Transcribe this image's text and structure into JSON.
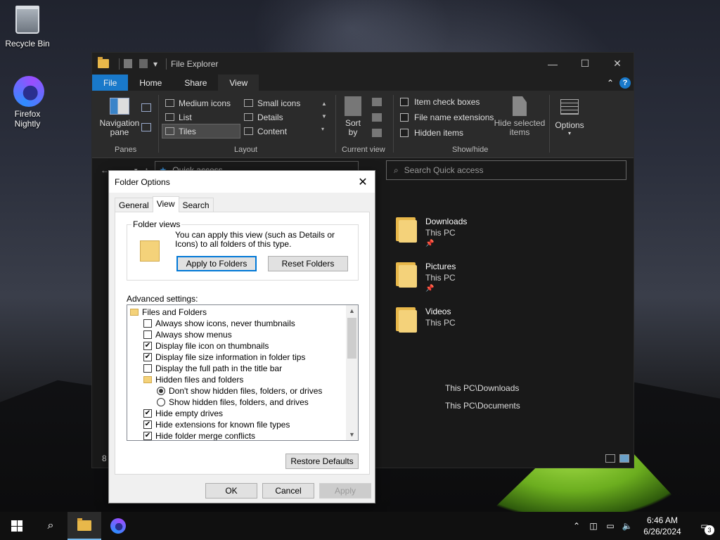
{
  "desktop": {
    "icons": [
      {
        "label": "Recycle Bin",
        "icon": "recycle-bin-icon"
      },
      {
        "label": "Firefox\nNightly",
        "icon": "firefox-nightly-icon"
      }
    ]
  },
  "explorer": {
    "title": "File Explorer",
    "menu": {
      "file": "File",
      "home": "Home",
      "share": "Share",
      "view": "View"
    },
    "ribbon": {
      "panes": {
        "nav_pane": "Navigation\npane",
        "group": "Panes"
      },
      "layout": {
        "group": "Layout",
        "items": [
          "Medium icons",
          "Small icons",
          "List",
          "Details",
          "Tiles",
          "Content"
        ],
        "selected": "Tiles"
      },
      "current_view": {
        "sort_by": "Sort\nby",
        "group": "Current view"
      },
      "show_hide": {
        "group": "Show/hide",
        "item_check_boxes": "Item check boxes",
        "file_name_extensions": "File name extensions",
        "hidden_items": "Hidden items",
        "hide_selected": "Hide selected\nitems"
      },
      "options": "Options"
    },
    "address": {
      "path": "Quick access",
      "search_placeholder": "Search Quick access"
    },
    "quick_access": [
      {
        "name": "Downloads",
        "location": "This PC",
        "pinned": true
      },
      {
        "name": "Pictures",
        "location": "This PC",
        "pinned": true
      },
      {
        "name": "Videos",
        "location": "This PC",
        "pinned": false
      }
    ],
    "recent_paths": [
      "This PC\\Downloads",
      "This PC\\Documents"
    ],
    "status_count": "8"
  },
  "dialog": {
    "title": "Folder Options",
    "tabs": [
      "General",
      "View",
      "Search"
    ],
    "active_tab": "View",
    "folder_views": {
      "legend": "Folder views",
      "description": "You can apply this view (such as Details or Icons) to all folders of this type.",
      "apply_button": "Apply to Folders",
      "reset_button": "Reset Folders"
    },
    "advanced_label": "Advanced settings:",
    "settings": [
      {
        "type": "folder",
        "label": "Files and Folders",
        "indent": 0
      },
      {
        "type": "check",
        "label": "Always show icons, never thumbnails",
        "checked": false,
        "indent": 1
      },
      {
        "type": "check",
        "label": "Always show menus",
        "checked": false,
        "indent": 1
      },
      {
        "type": "check",
        "label": "Display file icon on thumbnails",
        "checked": true,
        "indent": 1
      },
      {
        "type": "check",
        "label": "Display file size information in folder tips",
        "checked": true,
        "indent": 1
      },
      {
        "type": "check",
        "label": "Display the full path in the title bar",
        "checked": false,
        "indent": 1
      },
      {
        "type": "folder",
        "label": "Hidden files and folders",
        "indent": 1
      },
      {
        "type": "radio",
        "label": "Don't show hidden files, folders, or drives",
        "checked": true,
        "indent": 2
      },
      {
        "type": "radio",
        "label": "Show hidden files, folders, and drives",
        "checked": false,
        "indent": 2
      },
      {
        "type": "check",
        "label": "Hide empty drives",
        "checked": true,
        "indent": 1
      },
      {
        "type": "check",
        "label": "Hide extensions for known file types",
        "checked": true,
        "indent": 1
      },
      {
        "type": "check",
        "label": "Hide folder merge conflicts",
        "checked": true,
        "indent": 1
      }
    ],
    "restore_defaults": "Restore Defaults",
    "ok": "OK",
    "cancel": "Cancel",
    "apply": "Apply"
  },
  "taskbar": {
    "time": "6:46 AM",
    "date": "6/26/2024",
    "notification_count": "3"
  }
}
